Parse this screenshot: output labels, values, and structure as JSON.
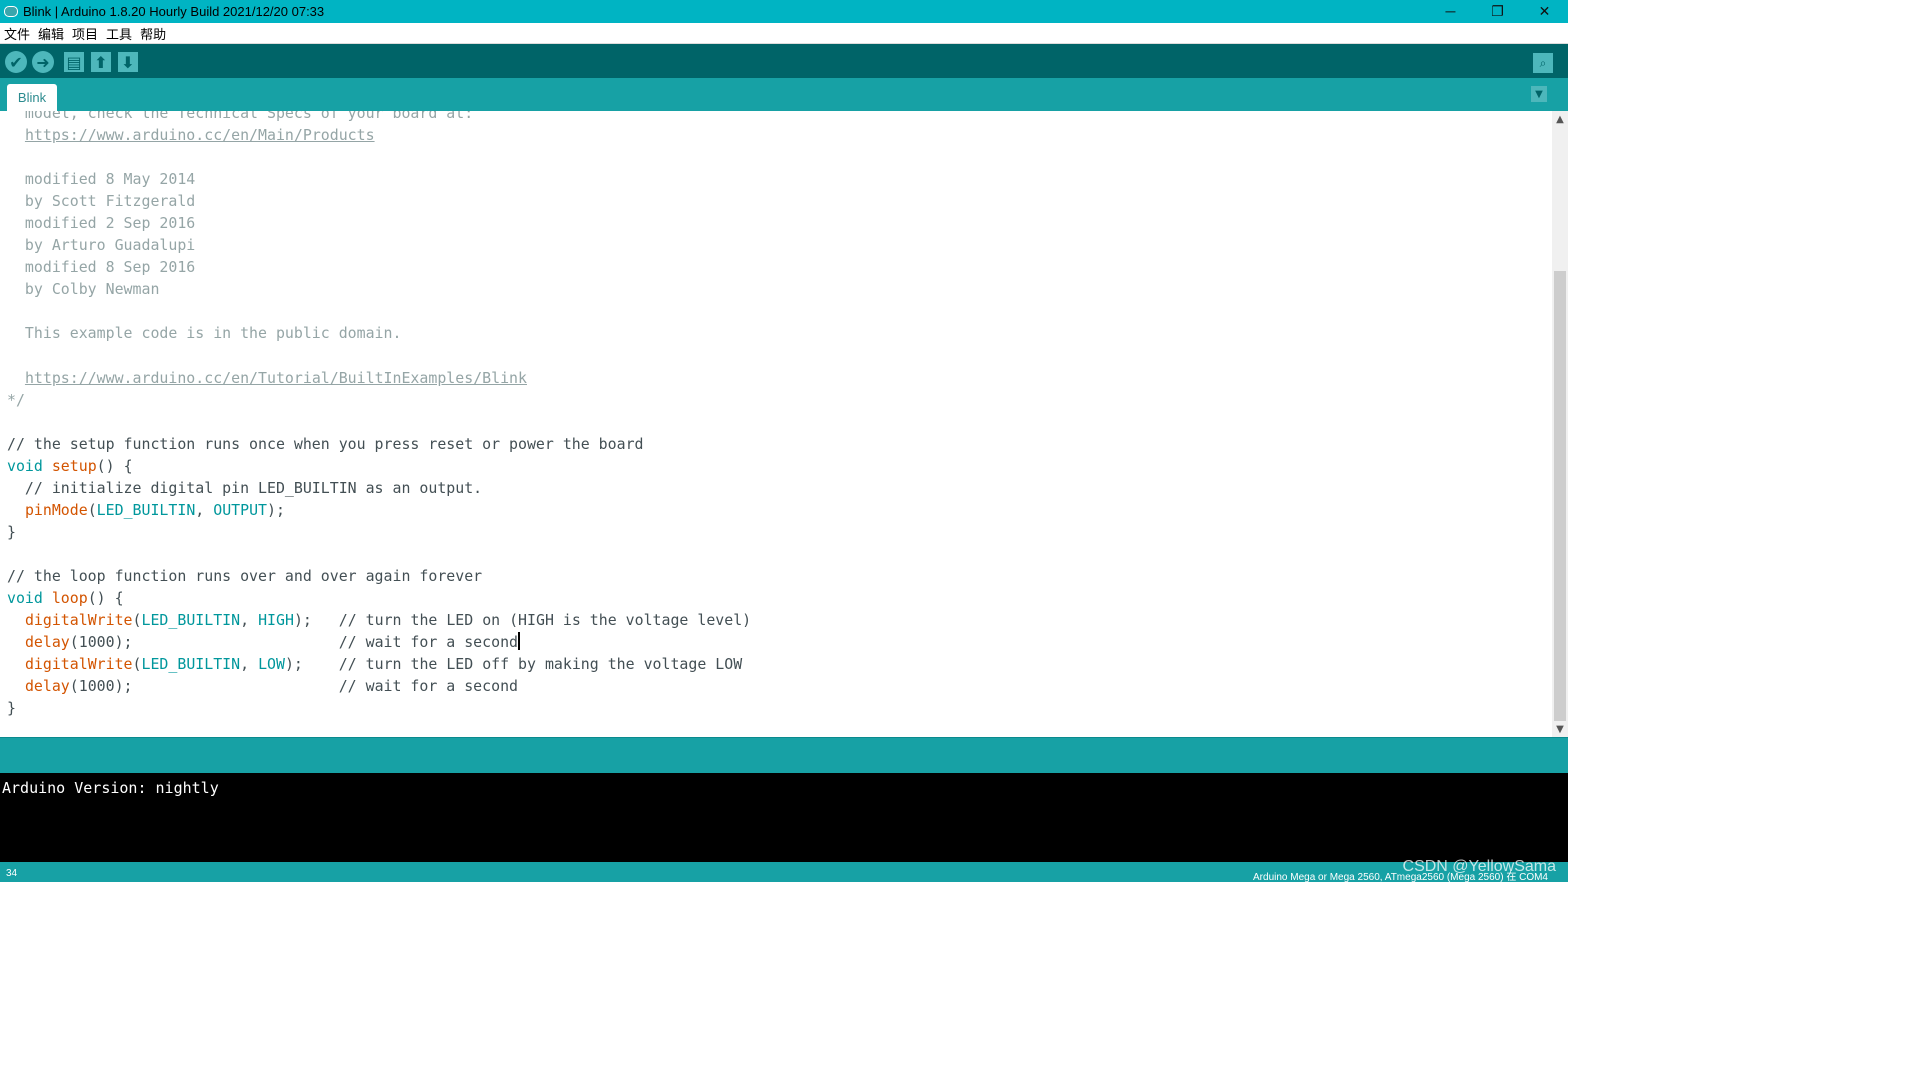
{
  "window": {
    "title": "Blink | Arduino 1.8.20 Hourly Build 2021/12/20 07:33",
    "minimize": "─",
    "restore": "❐",
    "close": "✕"
  },
  "menu": [
    "文件",
    "编辑",
    "项目",
    "工具",
    "帮助"
  ],
  "toolbar": {
    "verify_icon": "✔",
    "upload_icon": "➜",
    "new_icon": "▤",
    "open_icon": "⬆",
    "save_icon": "⬇",
    "serial_monitor_icon": "⌕"
  },
  "tabs": [
    {
      "label": "Blink"
    }
  ],
  "tab_menu_icon": "▼",
  "editor": {
    "lines": [
      {
        "segs": [
          {
            "t": "  model, check the Technical Specs of your board at:",
            "c": "c"
          }
        ]
      },
      {
        "segs": [
          {
            "t": "  ",
            "c": ""
          },
          {
            "t": "https://www.arduino.cc/en/Main/Products",
            "c": "u"
          }
        ]
      },
      {
        "segs": [
          {
            "t": "",
            "c": ""
          }
        ]
      },
      {
        "segs": [
          {
            "t": "  modified 8 May 2014",
            "c": "c"
          }
        ]
      },
      {
        "segs": [
          {
            "t": "  by Scott Fitzgerald",
            "c": "c"
          }
        ]
      },
      {
        "segs": [
          {
            "t": "  modified 2 Sep 2016",
            "c": "c"
          }
        ]
      },
      {
        "segs": [
          {
            "t": "  by Arturo Guadalupi",
            "c": "c"
          }
        ]
      },
      {
        "segs": [
          {
            "t": "  modified 8 Sep 2016",
            "c": "c"
          }
        ]
      },
      {
        "segs": [
          {
            "t": "  by Colby Newman",
            "c": "c"
          }
        ]
      },
      {
        "segs": [
          {
            "t": "",
            "c": ""
          }
        ]
      },
      {
        "segs": [
          {
            "t": "  This example code is in the public domain.",
            "c": "c"
          }
        ]
      },
      {
        "segs": [
          {
            "t": "",
            "c": ""
          }
        ]
      },
      {
        "segs": [
          {
            "t": "  ",
            "c": ""
          },
          {
            "t": "https://www.arduino.cc/en/Tutorial/BuiltInExamples/Blink",
            "c": "u"
          }
        ]
      },
      {
        "segs": [
          {
            "t": "*/",
            "c": "c"
          }
        ]
      },
      {
        "segs": [
          {
            "t": "",
            "c": ""
          }
        ]
      },
      {
        "segs": [
          {
            "t": "// the setup function runs once when you press reset or power the board",
            "c": ""
          }
        ]
      },
      {
        "segs": [
          {
            "t": "void",
            "c": "k"
          },
          {
            "t": " ",
            "c": ""
          },
          {
            "t": "setup",
            "c": "f"
          },
          {
            "t": "() {",
            "c": ""
          }
        ]
      },
      {
        "segs": [
          {
            "t": "  // initialize digital pin LED_BUILTIN as an output.",
            "c": ""
          }
        ]
      },
      {
        "segs": [
          {
            "t": "  ",
            "c": ""
          },
          {
            "t": "pinMode",
            "c": "f"
          },
          {
            "t": "(",
            "c": ""
          },
          {
            "t": "LED_BUILTIN",
            "c": "k"
          },
          {
            "t": ", ",
            "c": ""
          },
          {
            "t": "OUTPUT",
            "c": "k"
          },
          {
            "t": ");",
            "c": ""
          }
        ]
      },
      {
        "segs": [
          {
            "t": "}",
            "c": ""
          }
        ]
      },
      {
        "segs": [
          {
            "t": "",
            "c": ""
          }
        ]
      },
      {
        "segs": [
          {
            "t": "// the loop function runs over and over again forever",
            "c": ""
          }
        ]
      },
      {
        "segs": [
          {
            "t": "void",
            "c": "k"
          },
          {
            "t": " ",
            "c": ""
          },
          {
            "t": "loop",
            "c": "f"
          },
          {
            "t": "() {",
            "c": ""
          }
        ]
      },
      {
        "segs": [
          {
            "t": "  ",
            "c": ""
          },
          {
            "t": "digitalWrite",
            "c": "f"
          },
          {
            "t": "(",
            "c": ""
          },
          {
            "t": "LED_BUILTIN",
            "c": "k"
          },
          {
            "t": ", ",
            "c": ""
          },
          {
            "t": "HIGH",
            "c": "k"
          },
          {
            "t": ");   // turn the LED on (HIGH is the voltage level)",
            "c": ""
          }
        ]
      },
      {
        "segs": [
          {
            "t": "  ",
            "c": ""
          },
          {
            "t": "delay",
            "c": "f"
          },
          {
            "t": "(1000);                       // wait for a second",
            "c": ""
          },
          {
            "t": "",
            "c": "cursor"
          }
        ]
      },
      {
        "segs": [
          {
            "t": "  ",
            "c": ""
          },
          {
            "t": "digitalWrite",
            "c": "f"
          },
          {
            "t": "(",
            "c": ""
          },
          {
            "t": "LED_BUILTIN",
            "c": "k"
          },
          {
            "t": ", ",
            "c": ""
          },
          {
            "t": "LOW",
            "c": "k"
          },
          {
            "t": ");    // turn the LED off by making the voltage LOW",
            "c": ""
          }
        ]
      },
      {
        "segs": [
          {
            "t": "  ",
            "c": ""
          },
          {
            "t": "delay",
            "c": "f"
          },
          {
            "t": "(1000);                       // wait for a second",
            "c": ""
          }
        ]
      },
      {
        "segs": [
          {
            "t": "}",
            "c": ""
          }
        ]
      }
    ]
  },
  "console": {
    "text": "Arduino Version: nightly"
  },
  "status": {
    "line_number": "34",
    "board": "Arduino Mega or Mega 2560, ATmega2560 (Mega 2560) 在 COM4",
    "watermark": "CSDN @YellowSama"
  },
  "colors": {
    "titlebar": "#00b4c3",
    "toolbar": "#006468",
    "tabstrip": "#17a1a5",
    "comment": "#95a5a6",
    "keyword": "#00979c",
    "function": "#d35400"
  }
}
